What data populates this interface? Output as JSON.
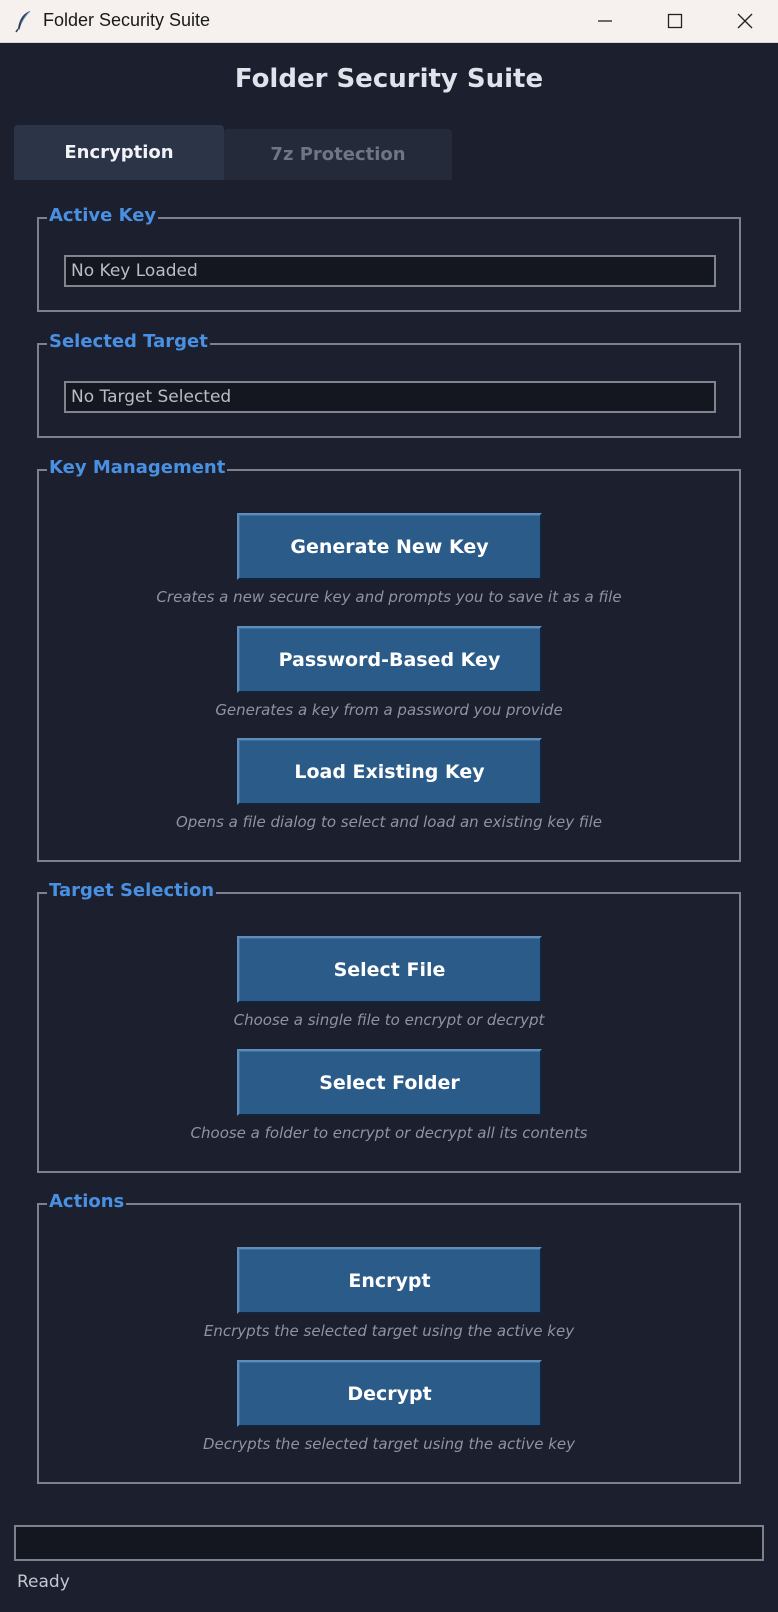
{
  "window": {
    "title": "Folder Security Suite"
  },
  "app": {
    "heading": "Folder Security Suite"
  },
  "tabs": [
    {
      "label": "Encryption",
      "active": true
    },
    {
      "label": "7z Protection",
      "active": false
    }
  ],
  "active_key": {
    "label": "Active Key",
    "value": "No Key Loaded"
  },
  "selected_target": {
    "label": "Selected Target",
    "value": "No Target Selected"
  },
  "key_management": {
    "label": "Key Management",
    "buttons": [
      {
        "label": "Generate New Key",
        "hint": "Creates a new secure key and prompts you to save it as a file"
      },
      {
        "label": "Password-Based Key",
        "hint": "Generates a key from a password you provide"
      },
      {
        "label": "Load Existing Key",
        "hint": "Opens a file dialog to select and load an existing key file"
      }
    ]
  },
  "target_selection": {
    "label": "Target Selection",
    "buttons": [
      {
        "label": "Select File",
        "hint": "Choose a single file to encrypt or decrypt"
      },
      {
        "label": "Select Folder",
        "hint": "Choose a folder to encrypt or decrypt all its contents"
      }
    ]
  },
  "actions": {
    "label": "Actions",
    "buttons": [
      {
        "label": "Encrypt",
        "hint": "Encrypts the selected target using the active key"
      },
      {
        "label": "Decrypt",
        "hint": "Decrypts the selected target using the active key"
      }
    ]
  },
  "progress": {
    "fraction": 0
  },
  "status": {
    "text": "Ready"
  },
  "colors": {
    "background": "#1b1f2e",
    "accent": "#4a90e2",
    "button": "#2b5b89"
  }
}
